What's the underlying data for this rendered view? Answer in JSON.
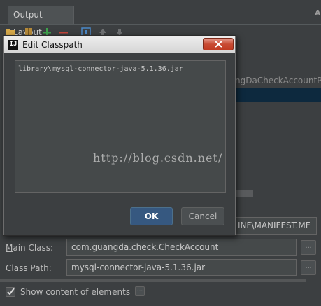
{
  "tabs": [
    {
      "label": "Output Layout"
    }
  ],
  "right_edge_letter": "A",
  "background": {
    "partial_item": "ngDaCheckAccountP",
    "manifest_path": "INF\\MANIFEST.MF"
  },
  "fields": {
    "main_class": {
      "label_prefix": "M",
      "label_rest": "ain Class:",
      "value": "com.guangda.check.CheckAccount",
      "browse": "..."
    },
    "class_path": {
      "label_prefix": "C",
      "label_rest": "lass Path:",
      "value": "mysql-connector-java-5.1.36.jar",
      "browse": "..."
    }
  },
  "show_content": {
    "label": "Show content of elements",
    "checked": true,
    "more": "..."
  },
  "dialog": {
    "app_icon": "IJ",
    "title": "Edit Classpath",
    "editor_before_caret": "library\\",
    "editor_after_caret": "mysql-connector-java-5.1.36.jar",
    "ok_label": "OK",
    "cancel_label": "Cancel"
  },
  "watermark": "http://blog.csdn.net/",
  "colors": {
    "accent": "#365880",
    "close_red": "#c84b33",
    "background": "#3c3f41",
    "selection": "#0d293e"
  },
  "icons": [
    "folder-icon",
    "archive-icon",
    "add-icon",
    "remove-icon",
    "module-icon",
    "move-up-icon",
    "move-down-icon",
    "close-icon",
    "check-icon"
  ]
}
